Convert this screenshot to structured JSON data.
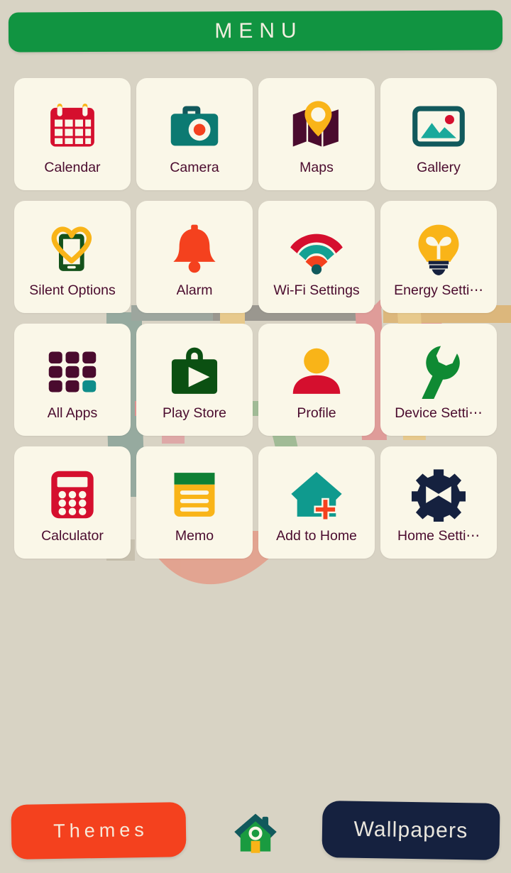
{
  "theme": {
    "background": "#d8d3c4",
    "tile_background": "#faf7e8",
    "label_color": "#4a0b2e",
    "header_green": "#119441",
    "themes_orange": "#f4411e",
    "wallpapers_navy": "#15213f",
    "crimson": "#d50f2e",
    "teal": "#0f9a8e",
    "dark_teal": "#11595c",
    "yellow": "#f9b418",
    "dark_green": "#0b5012",
    "plum": "#4a0b2e",
    "navy": "#15213f"
  },
  "header": {
    "title": "MENU"
  },
  "grid": {
    "apps": [
      {
        "label": "Calendar",
        "icon": "calendar-icon"
      },
      {
        "label": "Camera",
        "icon": "camera-icon"
      },
      {
        "label": "Maps",
        "icon": "maps-icon"
      },
      {
        "label": "Gallery",
        "icon": "gallery-icon"
      },
      {
        "label": "Silent Options",
        "icon": "silent-options-icon"
      },
      {
        "label": "Alarm",
        "icon": "bell-icon"
      },
      {
        "label": "Wi-Fi Settings",
        "icon": "wifi-icon"
      },
      {
        "label": "Energy Setti⋯",
        "icon": "lightbulb-icon"
      },
      {
        "label": "All Apps",
        "icon": "app-grid-icon"
      },
      {
        "label": "Play Store",
        "icon": "play-store-icon"
      },
      {
        "label": "Profile",
        "icon": "person-icon"
      },
      {
        "label": "Device Setti⋯",
        "icon": "wrench-icon"
      },
      {
        "label": "Calculator",
        "icon": "calculator-icon"
      },
      {
        "label": "Memo",
        "icon": "memo-icon"
      },
      {
        "label": "Add to Home",
        "icon": "add-to-home-icon"
      },
      {
        "label": "Home Setti⋯",
        "icon": "gear-icon"
      }
    ]
  },
  "bottom_bar": {
    "themes_label": "Themes",
    "wallpapers_label": "Wallpapers",
    "home_icon": "home-icon"
  }
}
